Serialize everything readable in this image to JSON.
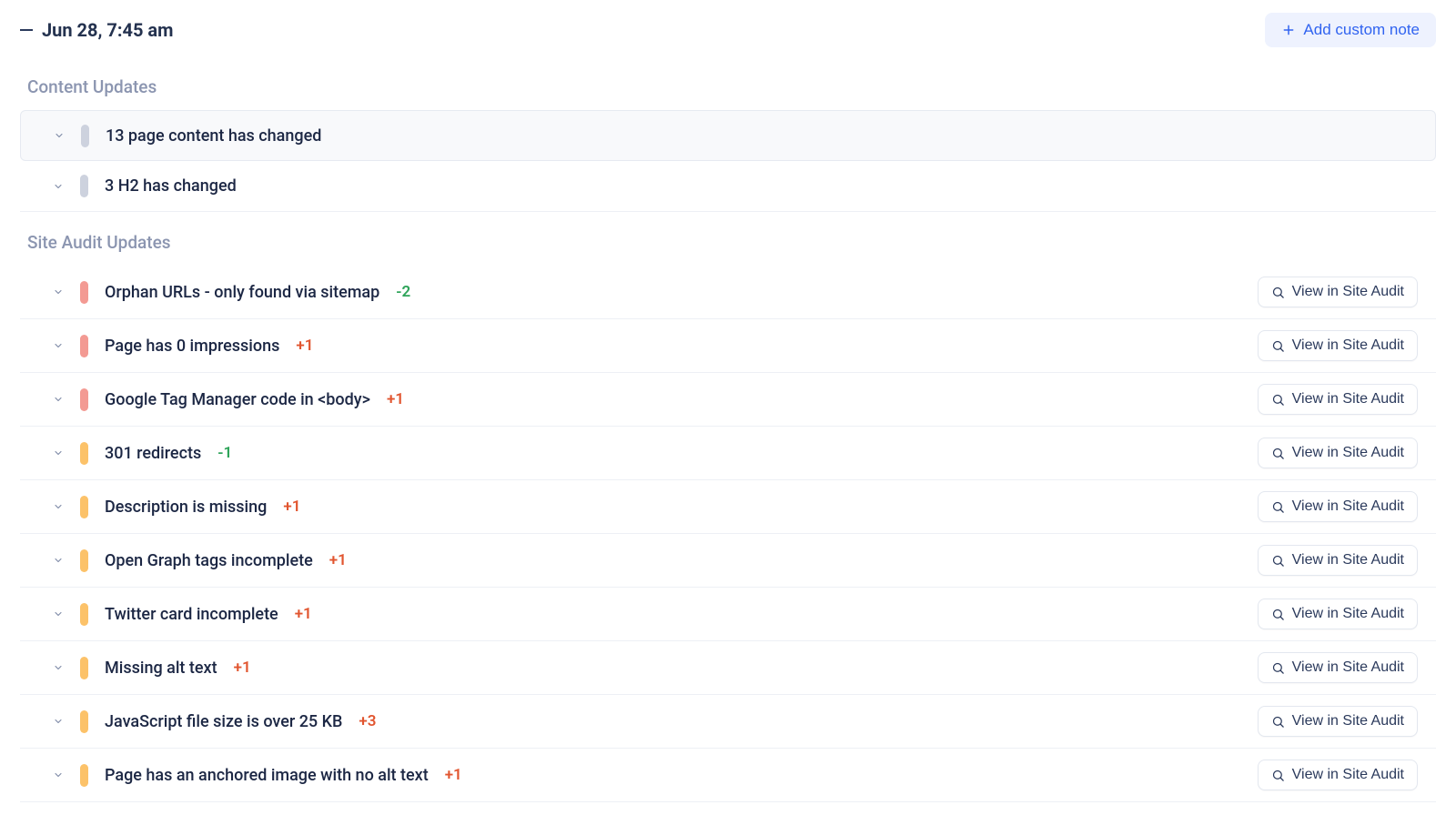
{
  "header": {
    "date_label": "Jun 28, 7:45 am",
    "add_note_label": "Add custom note"
  },
  "sections": [
    {
      "title": "Content Updates",
      "items": [
        {
          "pill": "gray",
          "text": "13 page content has changed",
          "delta": null,
          "highlight": true,
          "view_btn": false
        },
        {
          "pill": "gray",
          "text": "3 H2 has changed",
          "delta": null,
          "highlight": false,
          "view_btn": false
        }
      ]
    },
    {
      "title": "Site Audit Updates",
      "items": [
        {
          "pill": "red",
          "text": "Orphan URLs - only found via sitemap",
          "delta": "-2",
          "highlight": false,
          "view_btn": true
        },
        {
          "pill": "red",
          "text": "Page has 0 impressions",
          "delta": "+1",
          "highlight": false,
          "view_btn": true
        },
        {
          "pill": "red",
          "text": "Google Tag Manager code in <body>",
          "delta": "+1",
          "highlight": false,
          "view_btn": true
        },
        {
          "pill": "amber",
          "text": "301 redirects",
          "delta": "-1",
          "highlight": false,
          "view_btn": true
        },
        {
          "pill": "amber",
          "text": "Description is missing",
          "delta": "+1",
          "highlight": false,
          "view_btn": true
        },
        {
          "pill": "amber",
          "text": "Open Graph tags incomplete",
          "delta": "+1",
          "highlight": false,
          "view_btn": true
        },
        {
          "pill": "amber",
          "text": "Twitter card incomplete",
          "delta": "+1",
          "highlight": false,
          "view_btn": true
        },
        {
          "pill": "amber",
          "text": "Missing alt text",
          "delta": "+1",
          "highlight": false,
          "view_btn": true
        },
        {
          "pill": "amber",
          "text": "JavaScript file size is over 25 KB",
          "delta": "+3",
          "highlight": false,
          "view_btn": true
        },
        {
          "pill": "amber",
          "text": "Page has an anchored image with no alt text",
          "delta": "+1",
          "highlight": false,
          "view_btn": true
        }
      ]
    }
  ],
  "view_in_audit_label": "View in Site Audit"
}
